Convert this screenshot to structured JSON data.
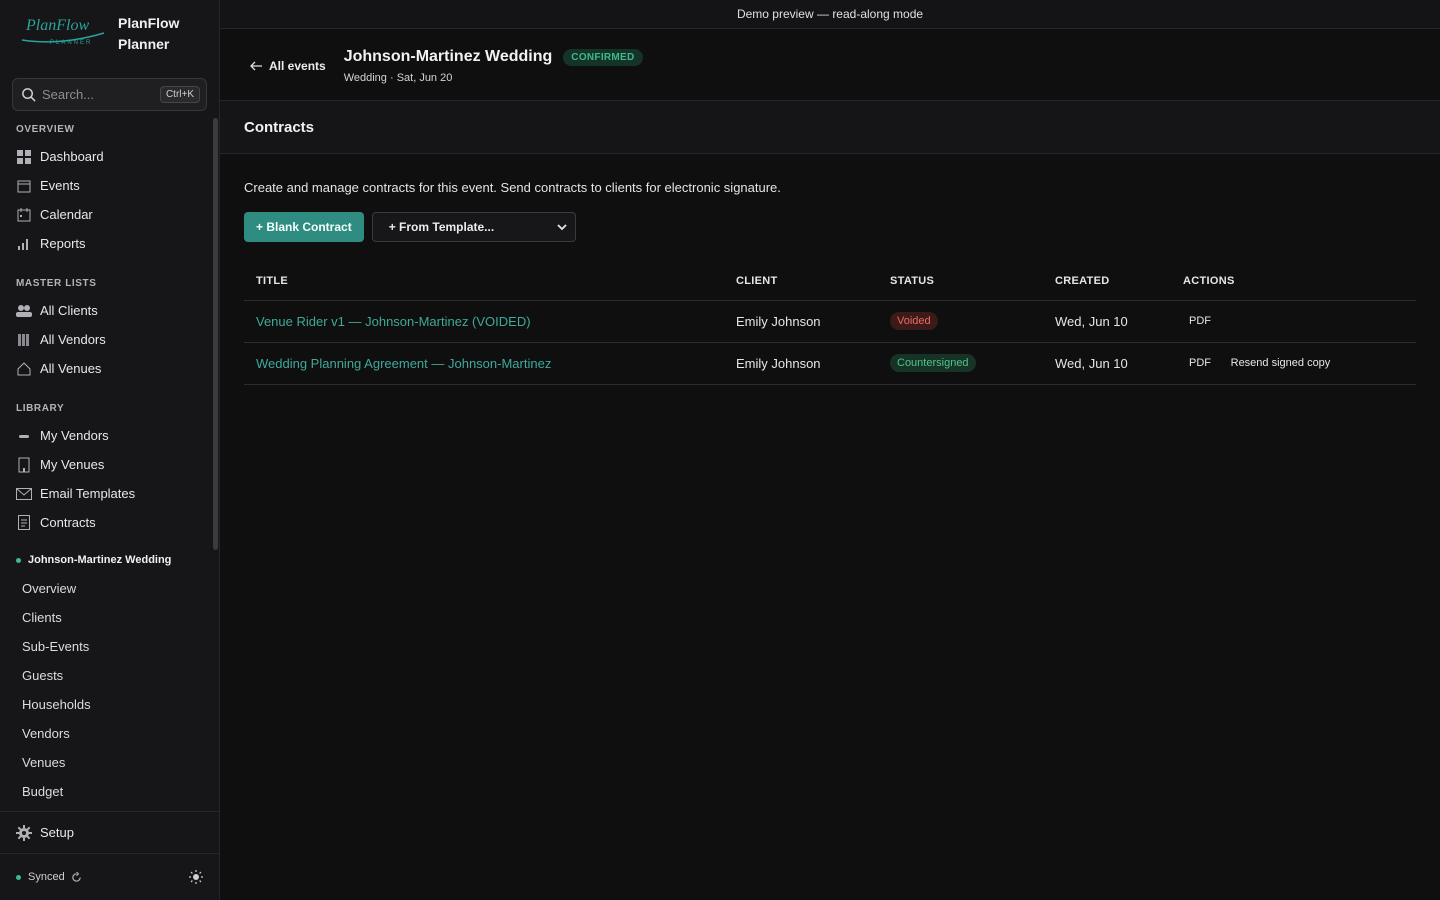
{
  "brand": {
    "logo_text": "PlanFlow",
    "logo_sub": "PLANNER",
    "name_line1": "PlanFlow",
    "name_line2": "Planner",
    "accent": "#2aa39a"
  },
  "search": {
    "placeholder": "Search...",
    "shortcut": "Ctrl+K"
  },
  "sidebar": {
    "overview_label": "OVERVIEW",
    "overview_items": [
      {
        "label": "Dashboard",
        "icon": "dashboard-icon"
      },
      {
        "label": "Events",
        "icon": "events-icon"
      },
      {
        "label": "Calendar",
        "icon": "calendar-icon"
      },
      {
        "label": "Reports",
        "icon": "reports-icon"
      }
    ],
    "master_label": "MASTER LISTS",
    "master_items": [
      {
        "label": "All Clients",
        "icon": "clients-icon"
      },
      {
        "label": "All Vendors",
        "icon": "vendors-icon"
      },
      {
        "label": "All Venues",
        "icon": "venues-icon"
      }
    ],
    "library_label": "LIBRARY",
    "library_items": [
      {
        "label": "My Vendors",
        "icon": "my-vendors-icon"
      },
      {
        "label": "My Venues",
        "icon": "my-venues-icon"
      },
      {
        "label": "Email Templates",
        "icon": "email-icon"
      },
      {
        "label": "Contracts",
        "icon": "contracts-icon"
      }
    ],
    "event_name": "Johnson-Martinez Wedding",
    "event_items": [
      "Overview",
      "Clients",
      "Sub-Events",
      "Guests",
      "Households",
      "Vendors",
      "Venues",
      "Budget"
    ],
    "setup_label": "Setup",
    "sync_status": "Synced"
  },
  "demo_banner": "Demo preview — read-along mode",
  "event": {
    "back_label": "All events",
    "title": "Johnson-Martinez Wedding",
    "status": "CONFIRMED",
    "subtitle": "Wedding · Sat, Jun 20"
  },
  "page": {
    "title": "Contracts",
    "description": "Create and manage contracts for this event. Send contracts to clients for electronic signature.",
    "blank_button": "+ Blank Contract",
    "template_select": "+ From Template..."
  },
  "table": {
    "headers": [
      "TITLE",
      "CLIENT",
      "STATUS",
      "CREATED",
      "ACTIONS"
    ],
    "rows": [
      {
        "title": "Venue Rider v1 — Johnson-Martinez (VOIDED)",
        "client": "Emily Johnson",
        "status": "Voided",
        "created": "Wed, Jun 10",
        "action1": "PDF"
      },
      {
        "title": "Wedding Planning Agreement — Johnson-Martinez",
        "client": "Emily Johnson",
        "status": "Countersigned",
        "created": "Wed, Jun 10",
        "action1": "PDF",
        "action2": "Resend signed copy"
      }
    ]
  },
  "colors": {
    "accent": "#2f8c80",
    "confirmed": "#3fb98a",
    "voided": "#ef6a5e",
    "countersigned": "#4fc48d"
  }
}
